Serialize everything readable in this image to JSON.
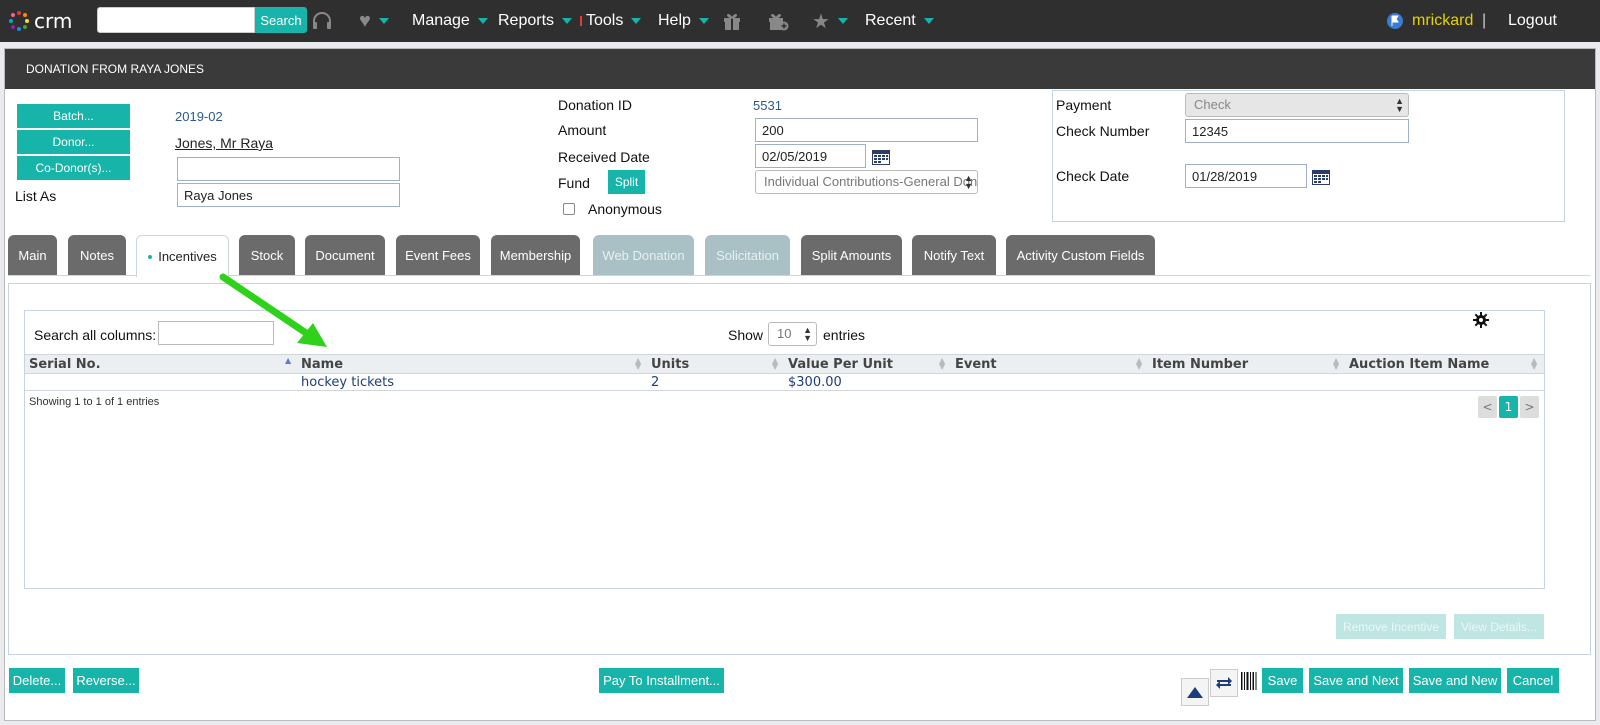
{
  "nav": {
    "logo_text": "crm",
    "search_placeholder": "",
    "search_button": "Search",
    "menu": [
      "Manage",
      "Reports",
      "Tools",
      "Help",
      "Recent"
    ],
    "user": "mrickard",
    "separator": "|",
    "logout": "Logout"
  },
  "header": {
    "title": "DONATION FROM RAYA JONES"
  },
  "donor": {
    "batch_button": "Batch...",
    "donor_button": "Donor...",
    "codonor_button": "Co-Donor(s)...",
    "batch_value": "2019-02",
    "donor_value": "Jones, Mr Raya",
    "codonor_value": "",
    "list_as_label": "List As",
    "list_as_value": "Raya Jones"
  },
  "donation": {
    "id_label": "Donation ID",
    "id_value": "5531",
    "amount_label": "Amount",
    "amount_value": "200",
    "received_label": "Received Date",
    "received_value": "02/05/2019",
    "fund_label": "Fund",
    "split_button": "Split",
    "fund_value": "Individual Contributions-General Donations",
    "anonymous_label": "Anonymous"
  },
  "payment": {
    "payment_label": "Payment",
    "payment_value": "Check",
    "check_number_label": "Check Number",
    "check_number_value": "12345",
    "check_date_label": "Check Date",
    "check_date_value": "01/28/2019"
  },
  "tabs": [
    "Main",
    "Notes",
    "Incentives",
    "Stock",
    "Document",
    "Event Fees",
    "Membership",
    "Web Donation",
    "Solicitation",
    "Split Amounts",
    "Notify Text",
    "Activity Custom Fields"
  ],
  "grid": {
    "search_label": "Search all columns:",
    "show_label": "Show",
    "entries_value": "10",
    "entries_label": "entries",
    "columns": [
      "Serial No.",
      "Name",
      "Units",
      "Value Per Unit",
      "Event",
      "Item Number",
      "Auction Item Name"
    ],
    "rows": [
      {
        "serial": "",
        "name": "hockey tickets",
        "units": "2",
        "value": "$300.00",
        "event": "",
        "item_number": "",
        "auction_name": ""
      }
    ],
    "info": "Showing 1 to 1 of 1 entries",
    "prev": "<",
    "page": "1",
    "next": ">"
  },
  "actions": {
    "remove_incentive": "Remove Incentive",
    "view_details": "View Details..."
  },
  "footer": {
    "delete": "Delete...",
    "reverse": "Reverse...",
    "pay_installment": "Pay To Installment...",
    "save": "Save",
    "save_next": "Save and Next",
    "save_new": "Save and New",
    "cancel": "Cancel"
  },
  "colors": {
    "accent": "#17b4a9",
    "nav_bg": "#2f2f2f",
    "arrow": "#2fd21a",
    "user": "#e5d200"
  }
}
